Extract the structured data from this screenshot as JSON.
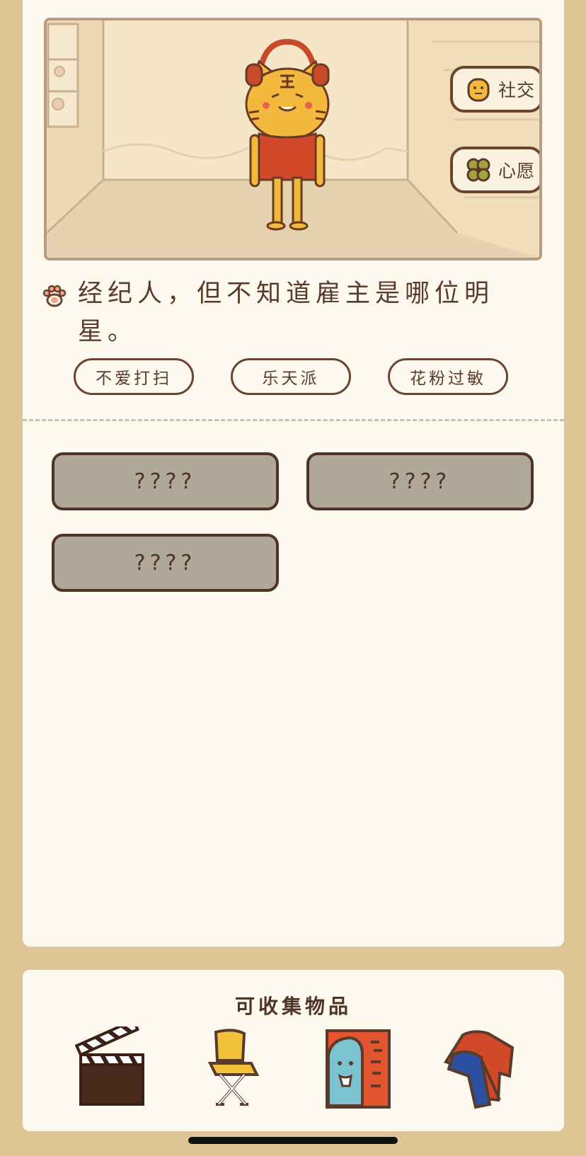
{
  "scene": {
    "side_buttons": [
      {
        "label": "社交",
        "icon": "character-icon"
      },
      {
        "label": "心愿",
        "icon": "clover-icon"
      }
    ]
  },
  "description": {
    "text": "经纪人，但不知道雇主是哪位明星。",
    "icon": "paw-icon"
  },
  "tags": [
    "不爱打扫",
    "乐天派",
    "花粉过敏"
  ],
  "slots": [
    "????",
    "????",
    "????"
  ],
  "collectibles": {
    "title": "可收集物品",
    "items": [
      "clapperboard-icon",
      "folding-chair-icon",
      "poster-icon",
      "jacket-icon"
    ]
  }
}
